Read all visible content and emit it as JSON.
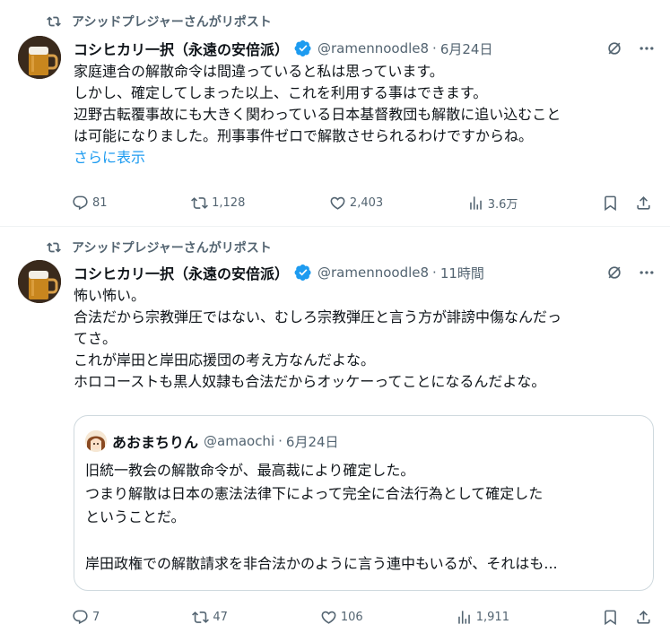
{
  "tweets": [
    {
      "repost_label": "アシッドプレジャーさんがリポスト",
      "display_name": "コシヒカリ一択（永遠の安倍派）",
      "handle": "@ramennoodle8",
      "separator": "·",
      "time": "6月24日",
      "lines": [
        "家庭連合の解散命令は間違っていると私は思っています。",
        "しかし、確定してしまった以上、これを利用する事はできます。",
        "辺野古転覆事故にも大きく関わっている日本基督教団も解散に追い込むこと",
        "は可能になりました。刑事事件ゼロで解散させられるわけですからね。"
      ],
      "show_more": "さらに表示",
      "replies": "81",
      "reposts": "1,128",
      "likes": "2,403",
      "views": "3.6万"
    },
    {
      "repost_label": "アシッドプレジャーさんがリポスト",
      "display_name": "コシヒカリ一択（永遠の安倍派）",
      "handle": "@ramennoodle8",
      "separator": "·",
      "time": "11時間",
      "lines": [
        "怖い怖い。",
        "合法だから宗教弾圧ではない、むしろ宗教弾圧と言う方が誹謗中傷なんだっ",
        "てさ。",
        "これが岸田と岸田応援団の考え方なんだよな。",
        "ホロコーストも黒人奴隷も合法だからオッケーってことになるんだよな。"
      ],
      "quote": {
        "display_name": "あおまちりん",
        "handle": "@amaochi",
        "separator": "·",
        "time": "6月24日",
        "lines": [
          "旧統一教会の解散命令が、最高裁により確定した。",
          "つまり解散は日本の憲法法律下によって完全に合法行為として確定した",
          "ということだ。",
          "",
          "岸田政権での解散請求を非合法かのように言う連中もいるが、それはも..."
        ]
      },
      "replies": "7",
      "reposts": "47",
      "likes": "106",
      "views": "1,911"
    }
  ],
  "colors": {
    "verified": "#1d9bf0",
    "link": "#1d9bf0",
    "secondary_text": "#536471",
    "border": "#cfd9de"
  }
}
